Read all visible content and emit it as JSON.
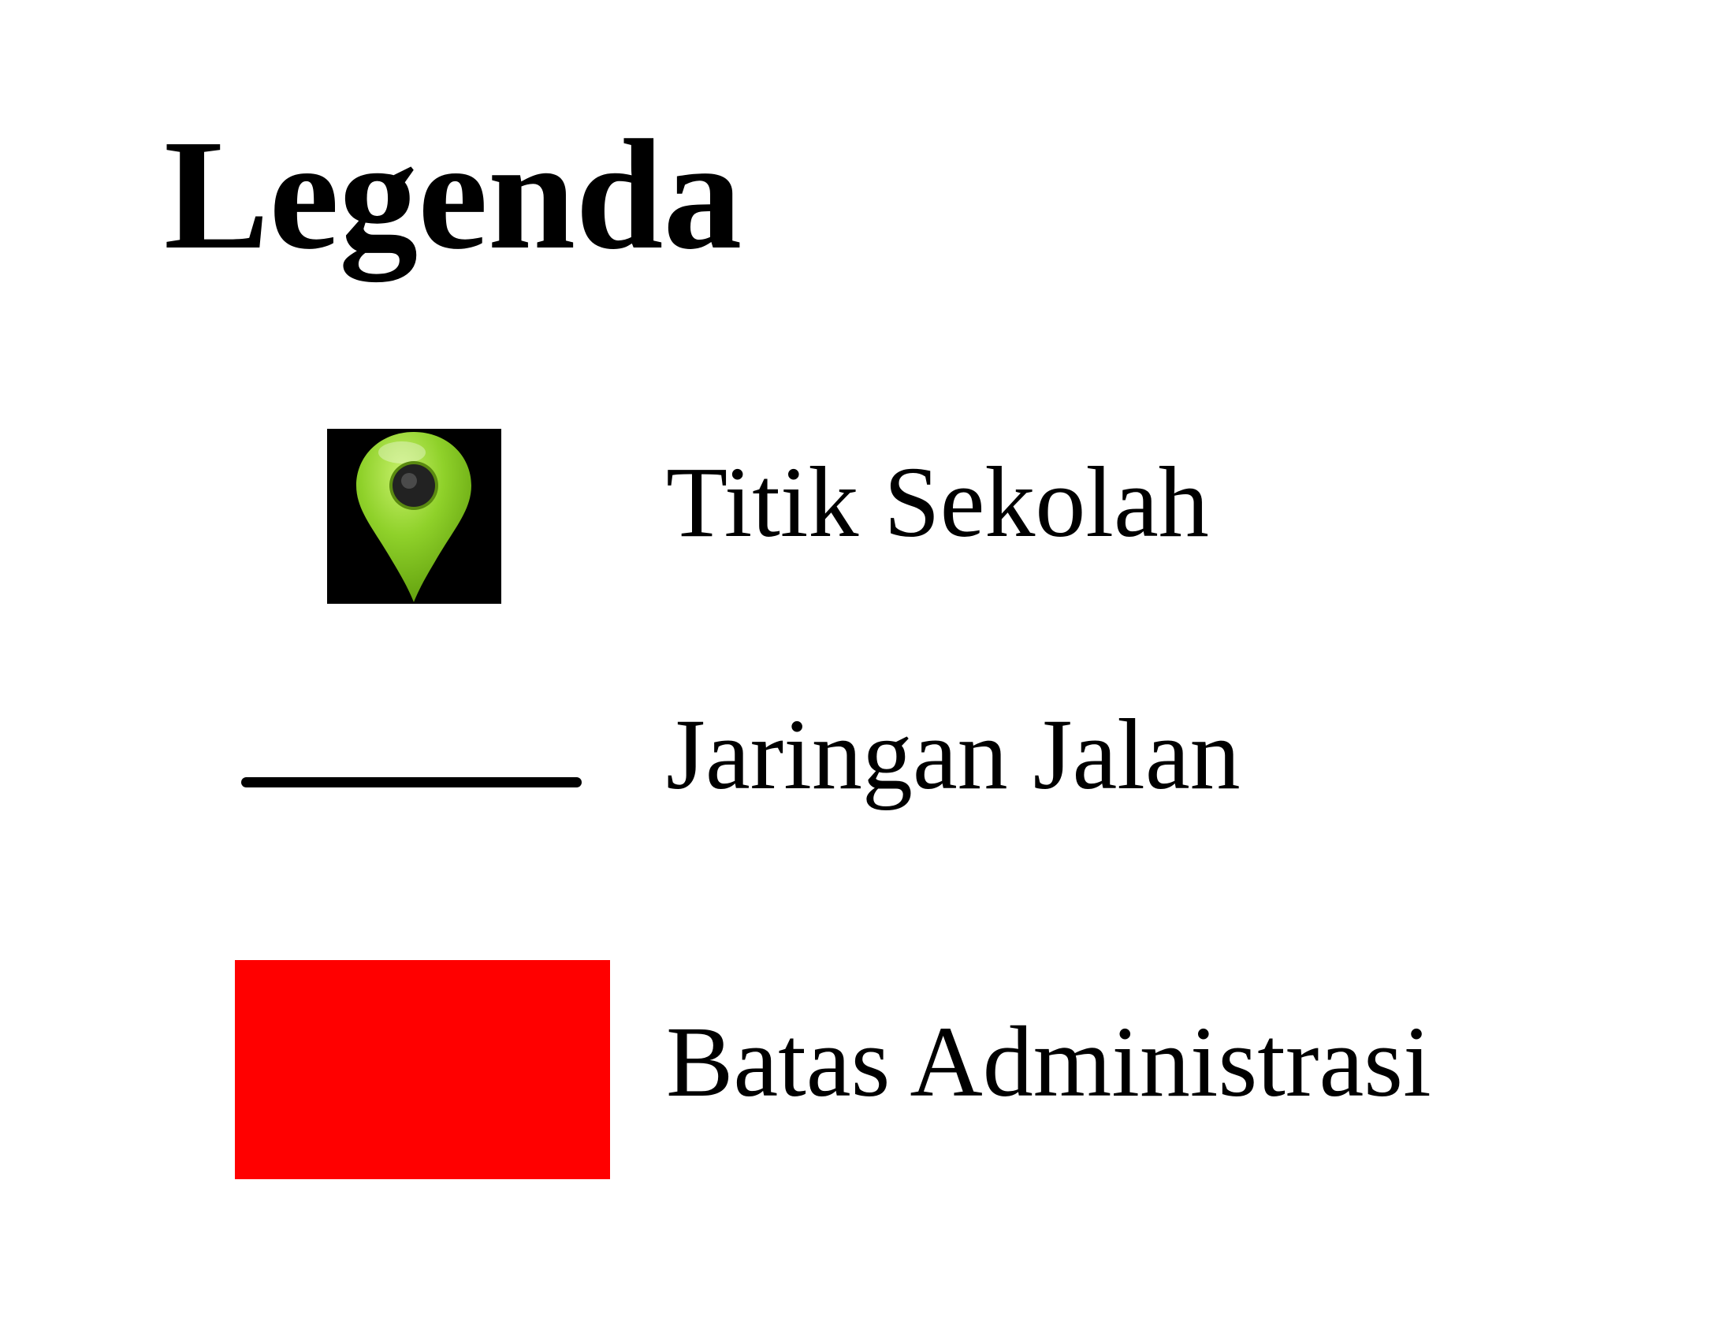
{
  "legend": {
    "title": "Legenda",
    "items": [
      {
        "label": "Titik Sekolah",
        "symbol": "green-map-pin-icon",
        "color": "#7dc21e"
      },
      {
        "label": "Jaringan Jalan",
        "symbol": "line",
        "color": "#000000"
      },
      {
        "label": "Batas Administrasi",
        "symbol": "filled-rectangle",
        "color": "#ff0000"
      }
    ]
  }
}
